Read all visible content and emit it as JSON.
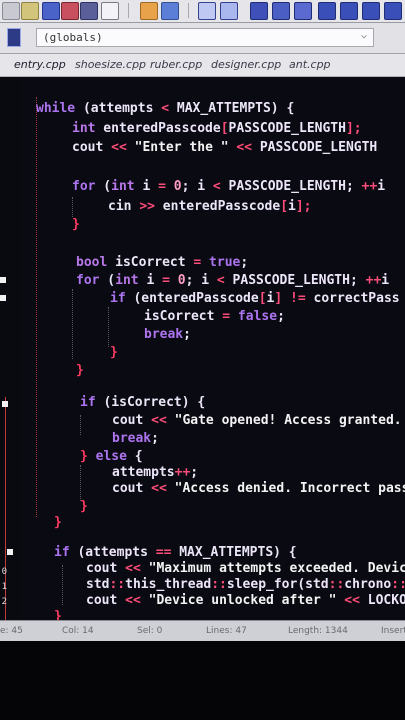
{
  "scope_combo": {
    "value": "(globals)"
  },
  "tabs": [
    "entry.cpp",
    "shoesize.cpp",
    "ruber.cpp",
    "designer.cpp",
    "ant.cpp"
  ],
  "gutter_numbers": [
    "0",
    "1",
    "2"
  ],
  "code_lines": [
    [
      [
        "kw",
        "while"
      ],
      [
        "fg",
        " (attempts "
      ],
      [
        "op",
        "<"
      ],
      [
        "fg",
        " MAX_ATTEMPTS) {"
      ]
    ],
    [
      [
        "tp",
        "int"
      ],
      [
        "fg",
        " enteredPasscode"
      ],
      [
        "op",
        "["
      ],
      [
        "fg",
        "PASSCODE_LENGTH"
      ],
      [
        "op",
        "];"
      ]
    ],
    [
      [
        "fg",
        "cout "
      ],
      [
        "op",
        "<<"
      ],
      [
        "st",
        " \"Enter the \" "
      ],
      [
        "op",
        "<<"
      ],
      [
        "fg",
        " PASSCODE_LENGTH"
      ]
    ],
    [
      [
        "kw",
        "for"
      ],
      [
        "fg",
        " ("
      ],
      [
        "tp",
        "int"
      ],
      [
        "fg",
        " i "
      ],
      [
        "op",
        "="
      ],
      [
        "fg",
        " "
      ],
      [
        "nm",
        "0"
      ],
      [
        "fg",
        "; i "
      ],
      [
        "op",
        "<"
      ],
      [
        "fg",
        " PASSCODE_LENGTH; "
      ],
      [
        "op",
        "++"
      ],
      [
        "fg",
        "i"
      ]
    ],
    [
      [
        "fg",
        "cin "
      ],
      [
        "op",
        ">>"
      ],
      [
        "fg",
        " enteredPasscode"
      ],
      [
        "op",
        "["
      ],
      [
        "fg",
        "i"
      ],
      [
        "op",
        "];"
      ]
    ],
    [
      [
        "br",
        "}"
      ]
    ],
    [
      [
        "tp",
        "bool"
      ],
      [
        "fg",
        " isCorrect "
      ],
      [
        "op",
        "="
      ],
      [
        "kw",
        " true"
      ],
      [
        "fg",
        ";"
      ]
    ],
    [
      [
        "kw",
        "for"
      ],
      [
        "fg",
        " ("
      ],
      [
        "tp",
        "int"
      ],
      [
        "fg",
        " i "
      ],
      [
        "op",
        "="
      ],
      [
        "fg",
        " "
      ],
      [
        "nm",
        "0"
      ],
      [
        "fg",
        "; i "
      ],
      [
        "op",
        "<"
      ],
      [
        "fg",
        " PASSCODE_LENGTH; "
      ],
      [
        "op",
        "++"
      ],
      [
        "fg",
        "i"
      ]
    ],
    [
      [
        "kw",
        "if"
      ],
      [
        "fg",
        " (enteredPasscode"
      ],
      [
        "op",
        "["
      ],
      [
        "fg",
        "i"
      ],
      [
        "op",
        "]"
      ],
      [
        "fg",
        " "
      ],
      [
        "op",
        "!="
      ],
      [
        "fg",
        " correctPass"
      ]
    ],
    [
      [
        "fg",
        "isCorrect "
      ],
      [
        "op",
        "="
      ],
      [
        "kw",
        " false"
      ],
      [
        "fg",
        ";"
      ]
    ],
    [
      [
        "kw",
        "break"
      ],
      [
        "fg",
        ";"
      ]
    ],
    [
      [
        "br",
        "}"
      ]
    ],
    [
      [
        "br",
        "}"
      ]
    ],
    [
      [
        "kw",
        "if"
      ],
      [
        "fg",
        " (isCorrect) {"
      ]
    ],
    [
      [
        "fg",
        "cout "
      ],
      [
        "op",
        "<<"
      ],
      [
        "st",
        " \"Gate opened! Access granted."
      ]
    ],
    [
      [
        "kw",
        "break"
      ],
      [
        "fg",
        ";"
      ]
    ],
    [
      [
        "br",
        "}"
      ],
      [
        "kw",
        " else"
      ],
      [
        "fg",
        " {"
      ]
    ],
    [
      [
        "fg",
        "attempts"
      ],
      [
        "op",
        "++"
      ],
      [
        "fg",
        ";"
      ]
    ],
    [
      [
        "fg",
        "cout "
      ],
      [
        "op",
        "<<"
      ],
      [
        "st",
        " \"Access denied. Incorrect pass"
      ]
    ],
    [
      [
        "br",
        "}"
      ]
    ],
    [
      [
        "br",
        "}"
      ]
    ],
    [
      [
        "kw",
        "if"
      ],
      [
        "fg",
        " (attempts "
      ],
      [
        "op",
        "=="
      ],
      [
        "fg",
        " MAX_ATTEMPTS) {"
      ]
    ],
    [
      [
        "fg",
        "cout "
      ],
      [
        "op",
        "<<"
      ],
      [
        "st",
        " \"Maximum attempts exceeded. Device"
      ]
    ],
    [
      [
        "fg",
        "std"
      ],
      [
        "op",
        "::"
      ],
      [
        "fg",
        "this_thread"
      ],
      [
        "op",
        "::"
      ],
      [
        "fg",
        "sleep_for(std"
      ],
      [
        "op",
        "::"
      ],
      [
        "fg",
        "chrono"
      ],
      [
        "op",
        "::"
      ],
      [
        "fg",
        "ho"
      ]
    ],
    [
      [
        "fg",
        "cout "
      ],
      [
        "op",
        "<<"
      ],
      [
        "st",
        " \"Device unlocked after \" "
      ],
      [
        "op",
        "<<"
      ],
      [
        "fg",
        " LOCKOUT"
      ]
    ],
    [
      [
        "br",
        "}"
      ]
    ]
  ],
  "status": {
    "line": "e: 45",
    "col": "Col: 14",
    "sel": "Sel: 0",
    "lines": "Lines: 47",
    "length": "Length: 1344",
    "mode": "Insert"
  }
}
